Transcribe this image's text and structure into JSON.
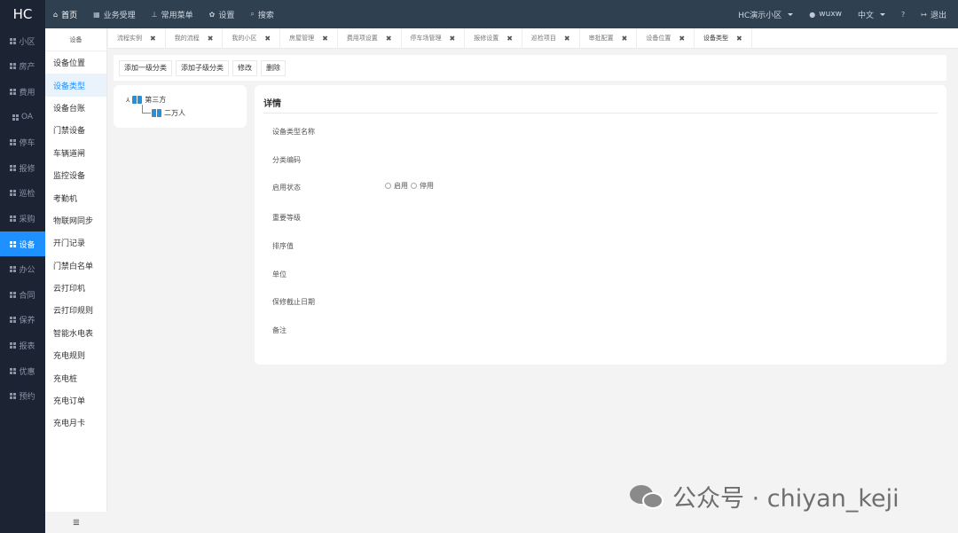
{
  "app": {
    "logo": "HC"
  },
  "topnav": {
    "items": [
      {
        "icon": "home-icon",
        "glyph": "⌂",
        "label": "首页",
        "active": true
      },
      {
        "icon": "calendar-icon",
        "glyph": "▦",
        "label": "业务受理"
      },
      {
        "icon": "sitemap-icon",
        "glyph": "⊥",
        "label": "常用菜单"
      },
      {
        "icon": "gear-icon",
        "glyph": "✿",
        "label": "设置"
      },
      {
        "icon": "search-icon",
        "glyph": "⌕",
        "label": "搜索"
      }
    ],
    "community": "HC演示小区",
    "user": "wuxw",
    "language": "中文",
    "help_glyph": "?",
    "logout": "退出"
  },
  "sidebar": {
    "items": [
      {
        "label": "小区"
      },
      {
        "label": "房产"
      },
      {
        "label": "费用"
      },
      {
        "label": "OA"
      },
      {
        "label": "停车"
      },
      {
        "label": "报修"
      },
      {
        "label": "巡检"
      },
      {
        "label": "采购"
      },
      {
        "label": "设备",
        "active": true
      },
      {
        "label": "办公"
      },
      {
        "label": "合同"
      },
      {
        "label": "保养"
      },
      {
        "label": "报表"
      },
      {
        "label": "优惠"
      },
      {
        "label": "预约"
      }
    ]
  },
  "submenu": {
    "title": "设备",
    "items": [
      {
        "label": "设备位置"
      },
      {
        "label": "设备类型",
        "active": true
      },
      {
        "label": "设备台账"
      },
      {
        "label": "门禁设备"
      },
      {
        "label": "车辆道闸"
      },
      {
        "label": "监控设备"
      },
      {
        "label": "考勤机"
      },
      {
        "label": "物联网同步"
      },
      {
        "label": "开门记录"
      },
      {
        "label": "门禁白名单"
      },
      {
        "label": "云打印机"
      },
      {
        "label": "云打印规则"
      },
      {
        "label": "智能水电表"
      },
      {
        "label": "充电规则"
      },
      {
        "label": "充电桩"
      },
      {
        "label": "充电订单"
      },
      {
        "label": "充电月卡"
      }
    ],
    "collapse_glyph": "≣"
  },
  "tabs": [
    {
      "label": "流程实例"
    },
    {
      "label": "我的流程"
    },
    {
      "label": "我的小区"
    },
    {
      "label": "房屋管理"
    },
    {
      "label": "费用项设置"
    },
    {
      "label": "停车场管理"
    },
    {
      "label": "报修设置"
    },
    {
      "label": "巡检项目"
    },
    {
      "label": "审批配置"
    },
    {
      "label": "设备位置"
    },
    {
      "label": "设备类型",
      "active": true
    }
  ],
  "tab_close_glyph": "✖",
  "toolbar": {
    "add_top": "添加一级分类",
    "add_child": "添加子级分类",
    "edit": "修改",
    "delete": "删除"
  },
  "tree": {
    "root": "第三方",
    "child": "二万人",
    "toggle_glyph": "⅄"
  },
  "detail": {
    "title": "详情",
    "fields": {
      "type_name": "设备类型名称",
      "category_code": "分类编码",
      "status": "启用状态",
      "importance": "重要等级",
      "sort": "排序值",
      "unit": "单位",
      "warranty": "保修截止日期",
      "remark": "备注"
    },
    "status_enabled": "启用",
    "status_disabled": "停用"
  },
  "watermark": "公众号 · chiyan_keji",
  "colors": {
    "topbar": "#2f4050",
    "sidebar": "#1c2434",
    "accent": "#1e90ff",
    "tree_icon": "#2b8fd8"
  }
}
